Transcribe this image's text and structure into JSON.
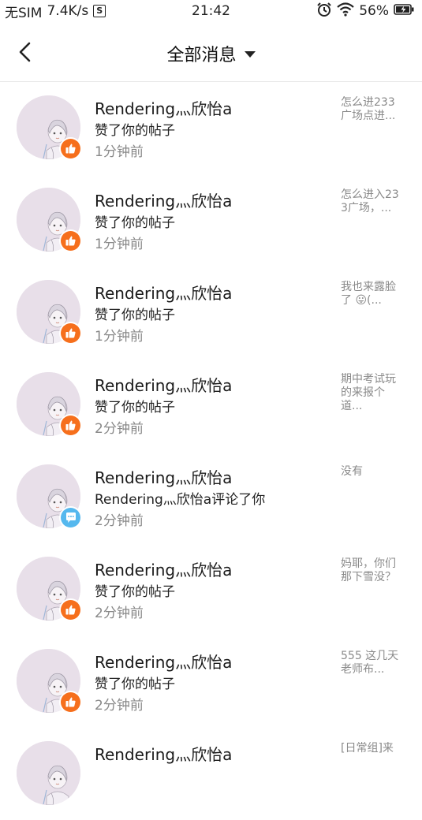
{
  "status_bar": {
    "carrier": "无SIM",
    "speed": "7.4K/s",
    "sim_glyph": "S",
    "time": "21:42",
    "battery": "56%"
  },
  "header": {
    "title": "全部消息"
  },
  "colors": {
    "like_badge": "#f66f1c",
    "comment_badge": "#55b8ee",
    "avatar_bg": "#e8dfe9"
  },
  "messages": [
    {
      "name": "Rendering灬欣怡a",
      "action": "赞了你的帖子",
      "time": "1分钟前",
      "preview": "怎么进233广场点进...",
      "badge": "like-icon"
    },
    {
      "name": "Rendering灬欣怡a",
      "action": "赞了你的帖子",
      "time": "1分钟前",
      "preview": "怎么进入233广场，...",
      "badge": "like-icon"
    },
    {
      "name": "Rendering灬欣怡a",
      "action": "赞了你的帖子",
      "time": "1分钟前",
      "preview": "我也来露脸了 😛(...",
      "badge": "like-icon"
    },
    {
      "name": "Rendering灬欣怡a",
      "action": "赞了你的帖子",
      "time": "2分钟前",
      "preview": "期中考试玩的来报个道...",
      "badge": "like-icon"
    },
    {
      "name": "Rendering灬欣怡a",
      "action": "Rendering灬欣怡a评论了你",
      "time": "2分钟前",
      "preview": "没有",
      "badge": "comment-icon"
    },
    {
      "name": "Rendering灬欣怡a",
      "action": "赞了你的帖子",
      "time": "2分钟前",
      "preview": "妈耶，你们那下雪没？",
      "badge": "like-icon"
    },
    {
      "name": "Rendering灬欣怡a",
      "action": "赞了你的帖子",
      "time": "2分钟前",
      "preview": "555 这几天老师布...",
      "badge": "like-icon"
    },
    {
      "name": "Rendering灬欣怡a",
      "action": "",
      "time": "",
      "preview": "[日常组]来",
      "badge": ""
    }
  ]
}
